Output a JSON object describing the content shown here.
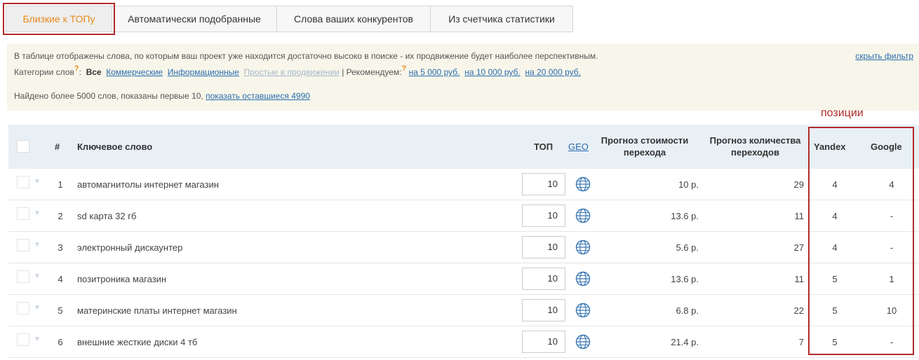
{
  "tabs": [
    {
      "label": "Близкие к ТОПу",
      "active": true
    },
    {
      "label": "Автоматически подобранные",
      "active": false
    },
    {
      "label": "Слова ваших конкурентов",
      "active": false
    },
    {
      "label": "Из счетчика статистики",
      "active": false
    }
  ],
  "info": {
    "description": "В таблице отображены слова, по которым ваш проект уже находится достаточно высоко в поиске - их продвижение будет наиболее перспективным.",
    "hide_filter": "скрыть фильтр",
    "categories_label": "Категории слов",
    "help_mark": "?",
    "cat_all": "Все",
    "cat_commercial": "Коммерческие",
    "cat_informational": "Информационные",
    "cat_easy": "Простые в продвижении",
    "separator": "|",
    "recommend_label": "Рекомендуем:",
    "rec_5000": "на 5 000 руб.",
    "rec_10000": "на 10 000 руб.",
    "rec_20000": "на 20 000 руб.",
    "found_text": "Найдено более 5000 слов, показаны первые 10,",
    "show_rest": "показать оставшиеся 4990"
  },
  "annotation": "позиции",
  "table": {
    "headers": {
      "num": "#",
      "keyword": "Ключевое слово",
      "top": "ТОП",
      "geo": "GEO",
      "cost_line1": "Прогноз стоимости",
      "cost_line2": "перехода",
      "clicks_line1": "Прогноз количества",
      "clicks_line2": "переходов",
      "yandex": "Yandex",
      "google": "Google"
    },
    "rows": [
      {
        "num": "1",
        "keyword": "автомагнитолы интернет магазин",
        "top": "10",
        "cost": "10 р.",
        "clicks": "29",
        "yandex": "4",
        "google": "4"
      },
      {
        "num": "2",
        "keyword": "sd карта 32 гб",
        "top": "10",
        "cost": "13.6 р.",
        "clicks": "11",
        "yandex": "4",
        "google": "-"
      },
      {
        "num": "3",
        "keyword": "электронный дискаунтер",
        "top": "10",
        "cost": "5.6 р.",
        "clicks": "27",
        "yandex": "4",
        "google": "-"
      },
      {
        "num": "4",
        "keyword": "позитроника магазин",
        "top": "10",
        "cost": "13.6 р.",
        "clicks": "11",
        "yandex": "5",
        "google": "1"
      },
      {
        "num": "5",
        "keyword": "материнские платы интернет магазин",
        "top": "10",
        "cost": "6.8 р.",
        "clicks": "22",
        "yandex": "5",
        "google": "10"
      },
      {
        "num": "6",
        "keyword": "внешние жесткие диски 4 тб",
        "top": "10",
        "cost": "21.4 р.",
        "clicks": "7",
        "yandex": "5",
        "google": "-"
      }
    ]
  }
}
